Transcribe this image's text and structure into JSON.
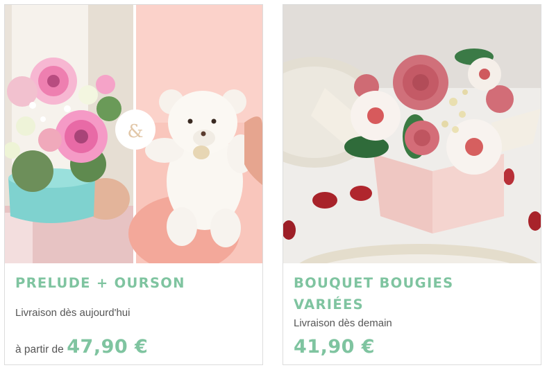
{
  "products": [
    {
      "title": "PRELUDE + OURSON",
      "delivery": "Livraison dès aujourd'hui",
      "price_prefix": "à partir de",
      "price": "47,90 €",
      "combo_symbol": "&",
      "image": "pink-gerbera-bouquet-in-blue-box-with-white-teddy-bear"
    },
    {
      "title": "BOUQUET BOUGIES VARIÉES",
      "delivery": "Livraison dès demain",
      "price": "41,90 €",
      "image": "candle-flower-bouquet-in-pink-box"
    }
  ],
  "colors": {
    "accent": "#7fc4a0",
    "text": "#555555",
    "border": "#dcdcdc"
  }
}
